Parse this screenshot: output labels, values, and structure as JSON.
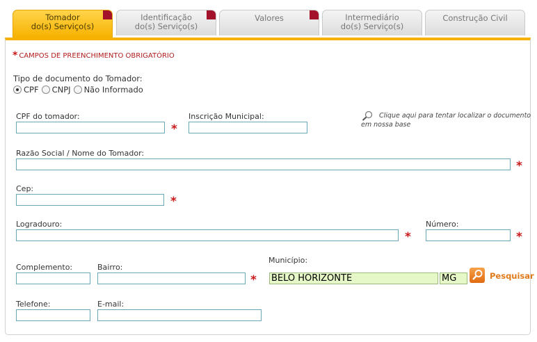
{
  "tabs": [
    {
      "line1": "Tomador",
      "line2": "do(s) Serviço(s)",
      "active": true
    },
    {
      "line1": "Identificação",
      "line2": "do(s) Serviço(s)",
      "active": false
    },
    {
      "line1": "Valores",
      "line2": "",
      "active": false
    },
    {
      "line1": "Intermediário",
      "line2": "do(s) Serviço(s)",
      "active": false
    },
    {
      "line1": "Construção Civil",
      "line2": "",
      "active": false
    }
  ],
  "required_note": "CAMPOS DE PREENCHIMENTO OBRIGATÓRIO",
  "required_marker": "*",
  "doc_type": {
    "label": "Tipo de documento do Tomador:",
    "options": [
      "CPF",
      "CNPJ",
      "Não Informado"
    ],
    "selected": "CPF"
  },
  "fields": {
    "cpf": {
      "label": "CPF do tomador:",
      "value": ""
    },
    "inscricao": {
      "label": "Inscrição Municipal:",
      "value": ""
    },
    "razao_social": {
      "label": "Razão Social / Nome do Tomador:",
      "value": ""
    },
    "cep": {
      "label": "Cep:",
      "value": ""
    },
    "logradouro": {
      "label": "Logradouro:",
      "value": ""
    },
    "numero": {
      "label": "Número:",
      "value": ""
    },
    "complemento": {
      "label": "Complemento:",
      "value": ""
    },
    "bairro": {
      "label": "Bairro:",
      "value": ""
    },
    "municipio": {
      "label": "Município:",
      "value": "BELO HORIZONTE",
      "uf": "MG"
    },
    "telefone": {
      "label": "Telefone:",
      "value": ""
    },
    "email": {
      "label": "E-mail:",
      "value": ""
    }
  },
  "search_hint": "Clique aqui para tentar localizar o documento em nossa base",
  "pesquisar_label": "Pesquisar",
  "colors": {
    "accent": "#f7b200",
    "required": "#c81a1a",
    "pesquisar": "#e07a1a"
  }
}
